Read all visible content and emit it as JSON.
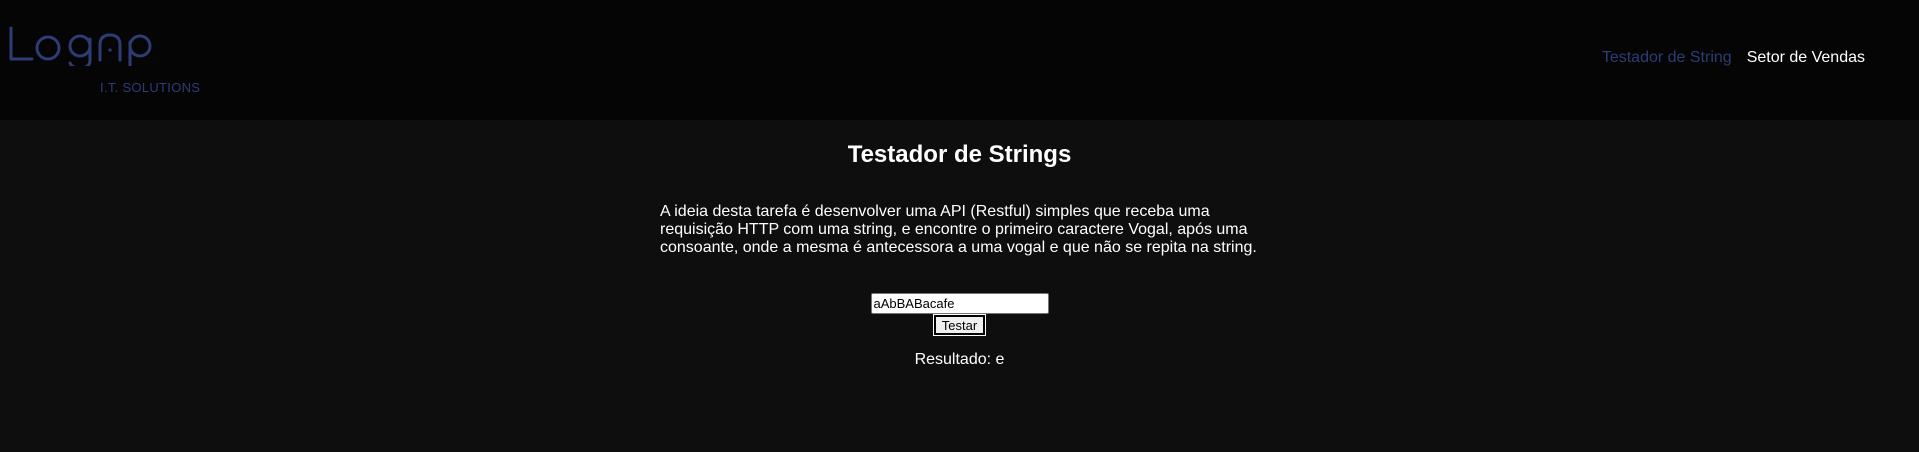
{
  "header": {
    "logo_text": "Logap",
    "logo_subtitle": "I.T. SOLUTIONS",
    "nav": [
      {
        "label": "Testador de String",
        "active": true
      },
      {
        "label": "Setor de Vendas",
        "active": false
      }
    ]
  },
  "main": {
    "title": "Testador de Strings",
    "description": "A ideia desta tarefa é desenvolver uma API (Restful) simples que receba uma requisição HTTP com uma string, e encontre o primeiro caractere Vogal, após uma consoante, onde a mesma é antecessora a uma vogal e que não se repita na string.",
    "input_value": "aAbBABacafe",
    "button_label": "Testar",
    "result_label": "Resultado:",
    "result_value": "e"
  },
  "colors": {
    "header_bg": "#050505",
    "page_bg": "#0e0e0e",
    "accent": "#2e3c75",
    "text": "#ffffff"
  }
}
